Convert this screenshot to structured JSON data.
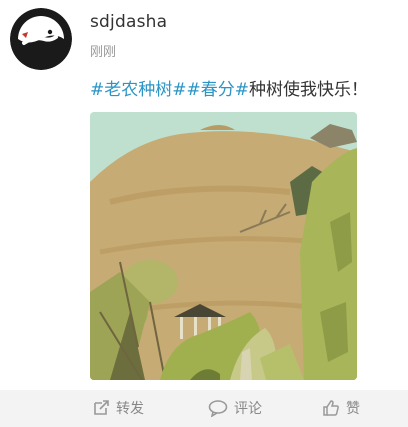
{
  "post": {
    "author": {
      "username": "sdjdasha"
    },
    "timestamp": "刚刚",
    "hashtags": [
      "#老农种树#",
      "#春分#"
    ],
    "body": "种树使我快乐！"
  },
  "actions": {
    "repost": {
      "label": "转发",
      "icon": "repost-icon"
    },
    "comment": {
      "label": "评论",
      "icon": "comment-icon"
    },
    "like": {
      "label": "赞",
      "icon": "thumbs-up-icon"
    }
  },
  "colors": {
    "hashtag": "#2b95c5",
    "text": "#333333",
    "muted": "#999999",
    "action_bar_bg": "#f3f3f3"
  }
}
